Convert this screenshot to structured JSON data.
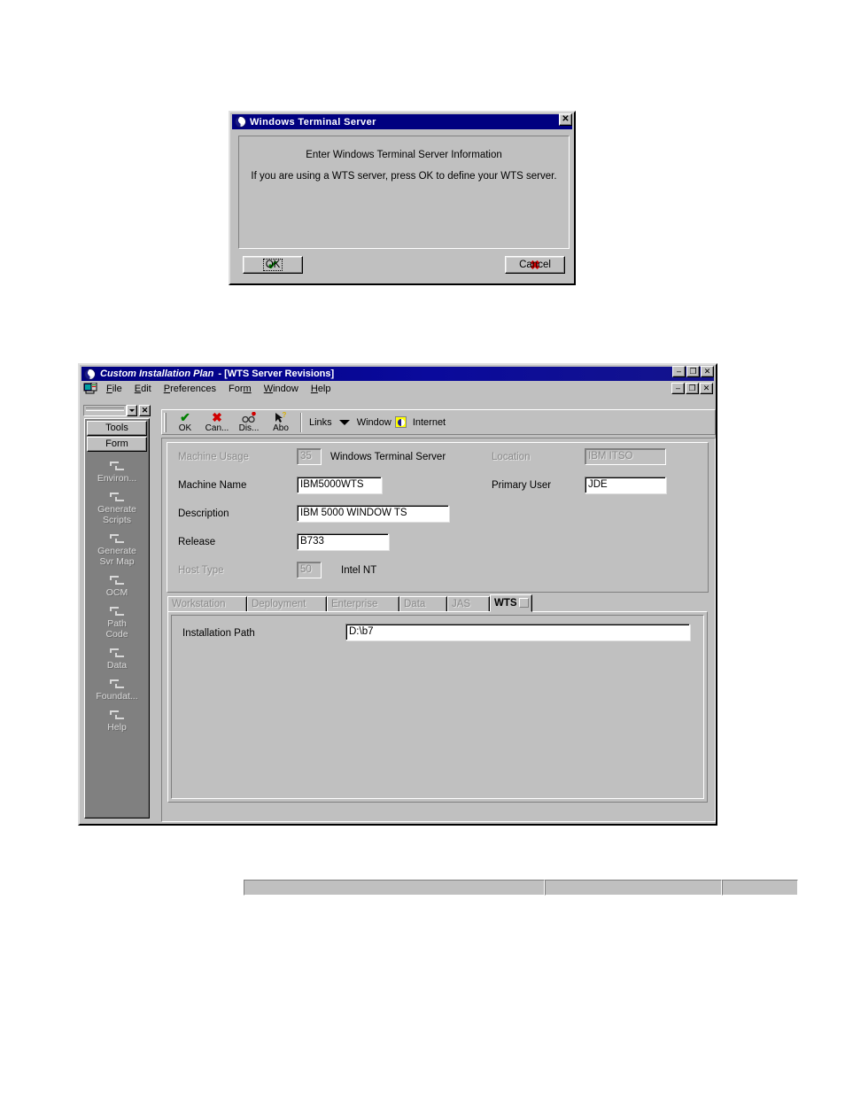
{
  "dialog": {
    "title": "Windows Terminal Server",
    "title_icon": "globe-icon",
    "close_label": "✕",
    "message_line1": "Enter Windows Terminal Server Information",
    "message_line2": "If you are using a WTS server, press OK to define your WTS server.",
    "ok_button": "OK",
    "ok_icon": "green-check-icon",
    "cancel_button": "Cancel",
    "cancel_icon": "red-x-icon"
  },
  "app": {
    "title": "Custom Installation Plan",
    "title_suffix": " - [WTS Server Revisions]",
    "title_icon": "globe-icon",
    "window_caps": [
      "–",
      "❐",
      "✕"
    ],
    "child_caps": [
      "–",
      "❐",
      "✕"
    ],
    "app_icon": "application-icon",
    "menu": [
      {
        "label": "File",
        "accel": "F"
      },
      {
        "label": "Edit",
        "accel": "E"
      },
      {
        "label": "Preferences",
        "accel": "P"
      },
      {
        "label": "Form",
        "accel": "m"
      },
      {
        "label": "Window",
        "accel": "W"
      },
      {
        "label": "Help",
        "accel": "H"
      }
    ],
    "toolbar": {
      "buttons": [
        {
          "label": "OK",
          "icon": "green-check-icon",
          "glyph": "✔"
        },
        {
          "label": "Can...",
          "icon": "red-x-icon",
          "glyph": "✖"
        },
        {
          "label": "Dis...",
          "icon": "glasses-pin-icon",
          "glyph": "⚭"
        },
        {
          "label": "Abo",
          "icon": "arrow-question-icon",
          "glyph": "↖"
        }
      ],
      "links_label": "Links",
      "dropdown_icon": "chevron-down-icon",
      "window_label": "Window",
      "internet_label": "Internet",
      "internet_icon": "internet-globe-icon"
    },
    "sidebar": {
      "combo_value": "",
      "dropdown_icon": "chevron-down-icon",
      "close_label": "✕",
      "tabs": [
        "Tools",
        "Form"
      ],
      "items": [
        {
          "label": "Environ...",
          "icon": "gear-icon"
        },
        {
          "label": "Generate\nScripts",
          "line1": "Generate",
          "line2": "Scripts",
          "icon": "gear-icon"
        },
        {
          "label": "Generate Svr Map",
          "line1": "Generate",
          "line2": "Svr Map",
          "icon": "gear-icon"
        },
        {
          "label": "OCM",
          "line1": "OCM",
          "line2": "",
          "icon": "gear-icon"
        },
        {
          "label": "Path Code",
          "line1": "Path",
          "line2": "Code",
          "icon": "gear-icon"
        },
        {
          "label": "Data",
          "line1": "Data",
          "line2": "",
          "icon": "gear-icon"
        },
        {
          "label": "Foundat...",
          "line1": "Foundat...",
          "line2": "",
          "icon": "gear-icon"
        },
        {
          "label": "Help",
          "line1": "Help",
          "line2": "",
          "icon": "gear-icon"
        }
      ]
    },
    "form": {
      "machine_usage_label": "Machine Usage",
      "machine_usage_value": "35",
      "machine_usage_desc": "Windows Terminal Server",
      "location_label": "Location",
      "location_value": "IBM ITSO",
      "machine_name_label": "Machine Name",
      "machine_name_value": "IBM5000WTS",
      "primary_user_label": "Primary User",
      "primary_user_value": "JDE",
      "description_label": "Description",
      "description_value": "IBM 5000 WINDOW TS",
      "release_label": "Release",
      "release_value": "B733",
      "host_type_label": "Host Type",
      "host_type_value": "50",
      "host_type_desc": "Intel NT"
    },
    "tabs": [
      {
        "label": "Workstation",
        "active": false
      },
      {
        "label": "Deployment",
        "active": false
      },
      {
        "label": "Enterprise",
        "active": false
      },
      {
        "label": "Data",
        "active": false
      },
      {
        "label": "JAS",
        "active": false
      },
      {
        "label": "WTS",
        "active": true
      }
    ],
    "wts_page": {
      "installation_path_label": "Installation Path",
      "installation_path_value": "D:\\b7"
    },
    "statusbar": {
      "panel1": "",
      "panel2": "",
      "panel3": "",
      "globe_icon": "globe-icon"
    }
  },
  "colors": {
    "face": "#c0c0c0",
    "titlebar": "#000080",
    "titlebar_text": "#ffffff",
    "disabled_text": "#8a8a8a",
    "check_green": "#008000",
    "x_red": "#d00000",
    "sidebar_bg": "#808080"
  }
}
